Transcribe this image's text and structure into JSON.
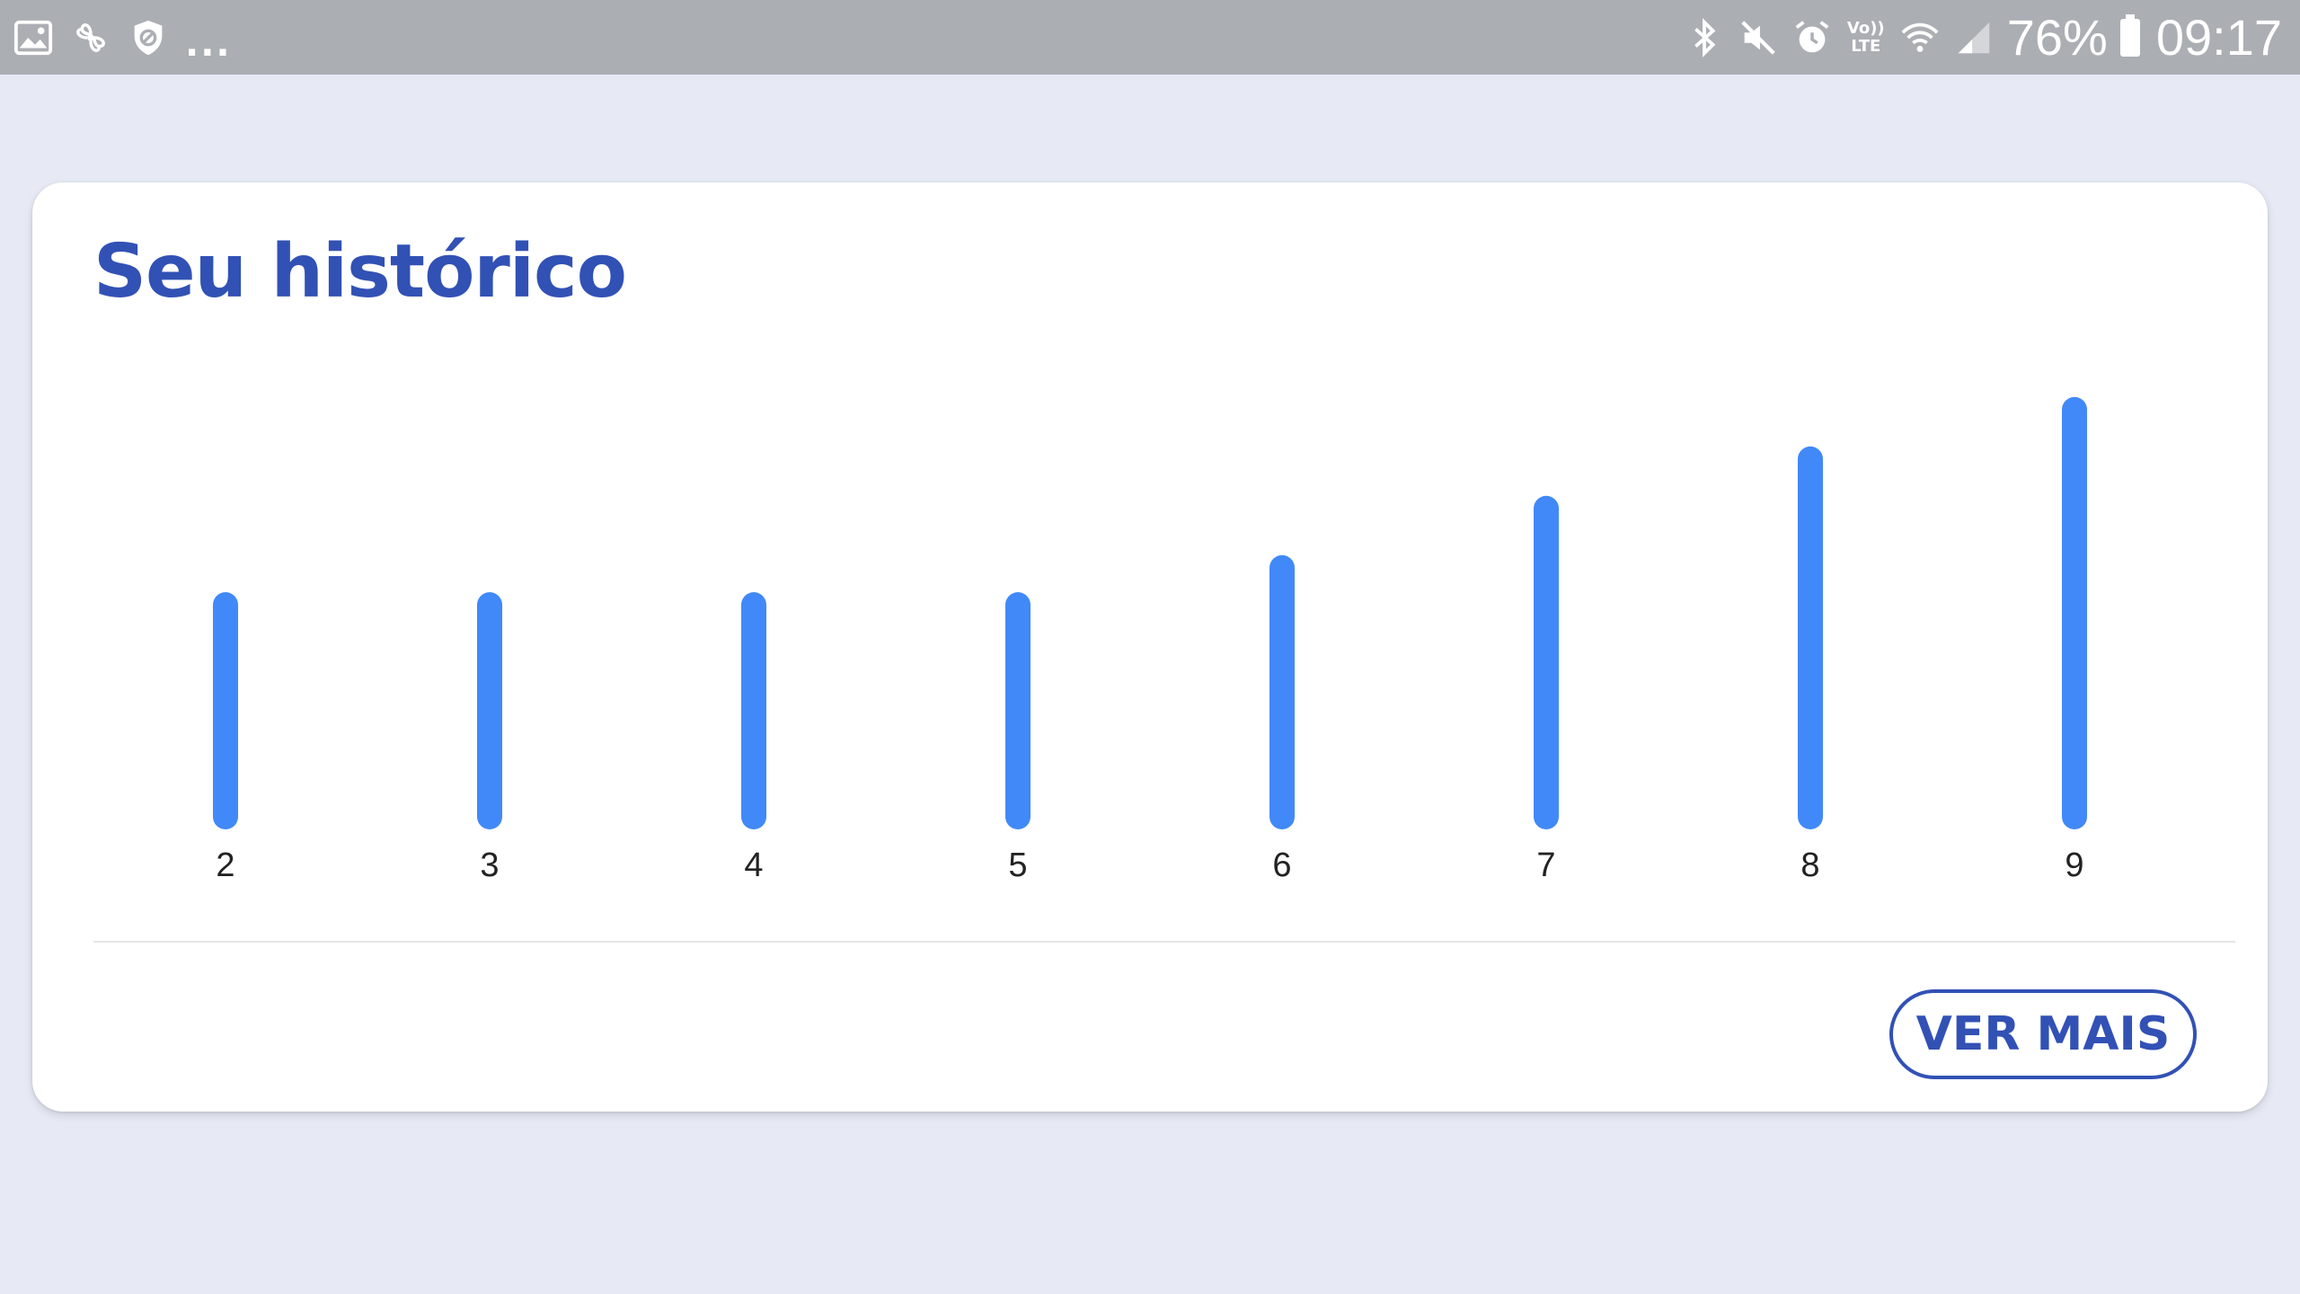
{
  "status_bar": {
    "left_icons": [
      "gallery-icon",
      "fan-icon",
      "shield-icon"
    ],
    "overflow": "...",
    "right_icons": [
      "bluetooth-icon",
      "mute-icon",
      "alarm-icon",
      "volte-icon",
      "wifi-icon",
      "signal-icon",
      "battery-icon"
    ],
    "volte_top": "Vo))",
    "volte_bottom": "LTE",
    "battery": "76%",
    "time": "09:17",
    "background_color": "#abaeb3"
  },
  "card": {
    "title": "Seu histórico",
    "button_label": "VER MAIS",
    "accent_color": "#3251b5",
    "bar_color": "#4189f8"
  },
  "chart_data": {
    "type": "bar",
    "categories": [
      "2",
      "3",
      "4",
      "5",
      "6",
      "7",
      "8",
      "9"
    ],
    "values": [
      9.6,
      9.6,
      9.6,
      9.6,
      11.1,
      13.5,
      15.5,
      17.5
    ],
    "ylim": [
      0,
      18
    ],
    "grid": false,
    "title": "",
    "xlabel": "",
    "ylabel": ""
  }
}
